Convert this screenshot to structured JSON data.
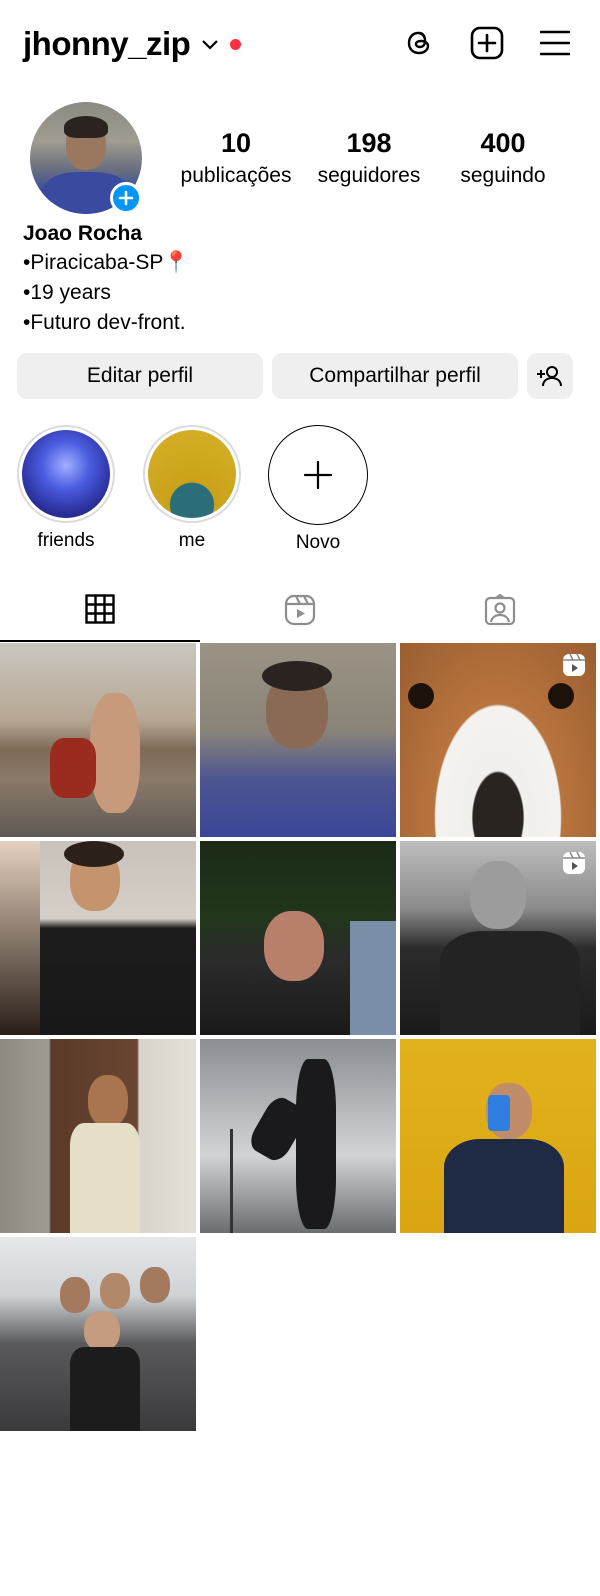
{
  "profile": {
    "username": "jhonny_zip",
    "name": "Joao Rocha",
    "bio_lines": [
      "•Piracicaba-SP📍",
      "•19 years",
      "•Futuro dev-front."
    ]
  },
  "stats": {
    "posts": {
      "value": "10",
      "label": "publicações"
    },
    "followers": {
      "value": "198",
      "label": "seguidores"
    },
    "following": {
      "value": "400",
      "label": "seguindo"
    }
  },
  "actions": {
    "edit_label": "Editar perfil",
    "share_label": "Compartilhar perfil"
  },
  "highlights": [
    {
      "label": "friends"
    },
    {
      "label": "me"
    },
    {
      "label": "Novo"
    }
  ],
  "tabs": [
    {
      "icon": "grid-icon",
      "active": true
    },
    {
      "icon": "reels-icon",
      "active": false
    },
    {
      "icon": "tagged-icon",
      "active": false
    }
  ],
  "posts": [
    {
      "type": "photo"
    },
    {
      "type": "photo"
    },
    {
      "type": "reel"
    },
    {
      "type": "photo"
    },
    {
      "type": "photo"
    },
    {
      "type": "reel"
    },
    {
      "type": "photo"
    },
    {
      "type": "photo"
    },
    {
      "type": "photo"
    },
    {
      "type": "photo"
    }
  ],
  "colors": {
    "accent": "#0095f6",
    "notification_dot": "#ff3040",
    "button_bg": "#efefef"
  }
}
